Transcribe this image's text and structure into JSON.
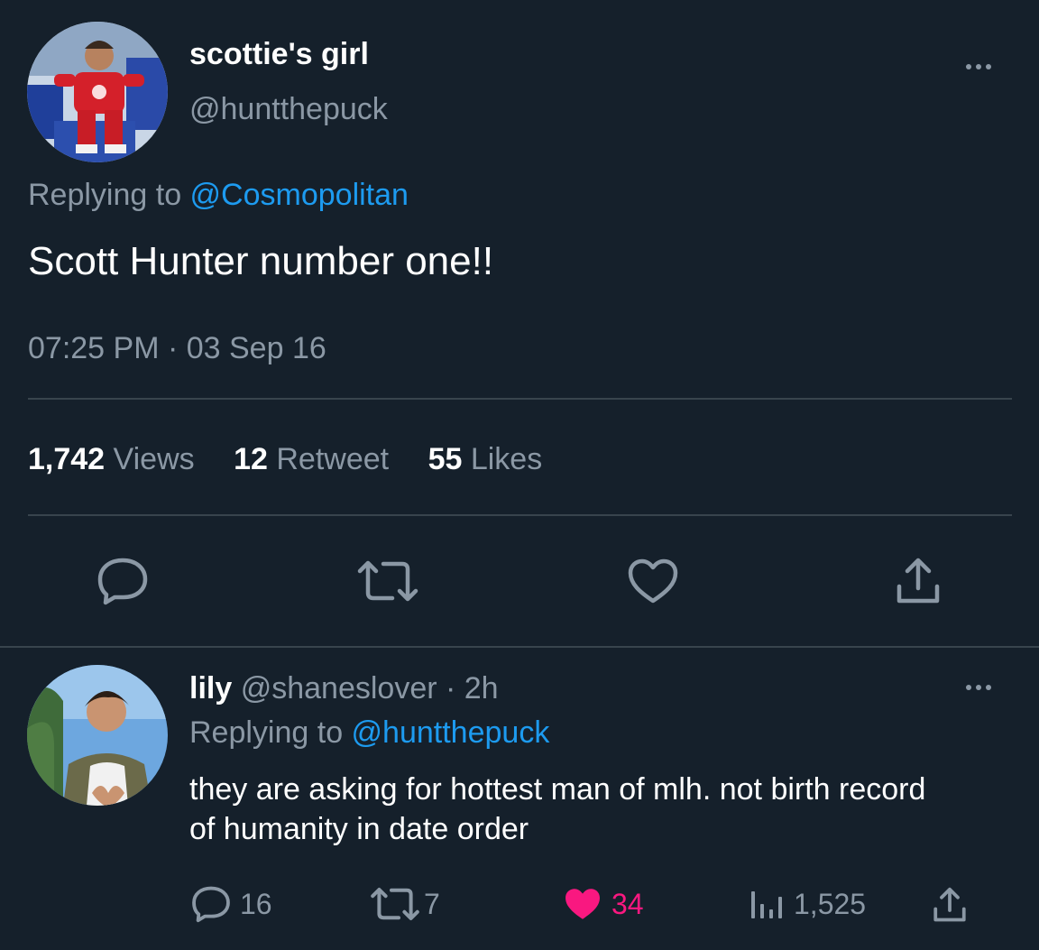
{
  "tweet": {
    "display_name": "scottie's girl",
    "handle": "@huntthepuck",
    "replying_prefix": "Replying to ",
    "replying_to": "@Cosmopolitan",
    "text": "Scott Hunter number one!!",
    "timestamp": "07:25 PM · 03 Sep 16",
    "stats": {
      "views_count": "1,742",
      "views_label": "Views",
      "retweets_count": "12",
      "retweets_label": "Retweet",
      "likes_count": "55",
      "likes_label": "Likes"
    },
    "actions": [
      "reply-icon",
      "retweet-icon",
      "heart-icon",
      "share-icon"
    ]
  },
  "reply": {
    "display_name": "lily",
    "handle_time": "@shaneslover · 2h",
    "replying_prefix": "Replying to ",
    "replying_to": "@huntthepuck",
    "text": "they are asking for hottest man of mlh. not birth record of humanity in date order",
    "counts": {
      "replies": "16",
      "retweets": "7",
      "likes": "34",
      "views": "1,525"
    }
  },
  "colors": {
    "background": "#15202b",
    "link": "#1d9bf0",
    "muted": "#8b98a5",
    "liked": "#f91880"
  }
}
